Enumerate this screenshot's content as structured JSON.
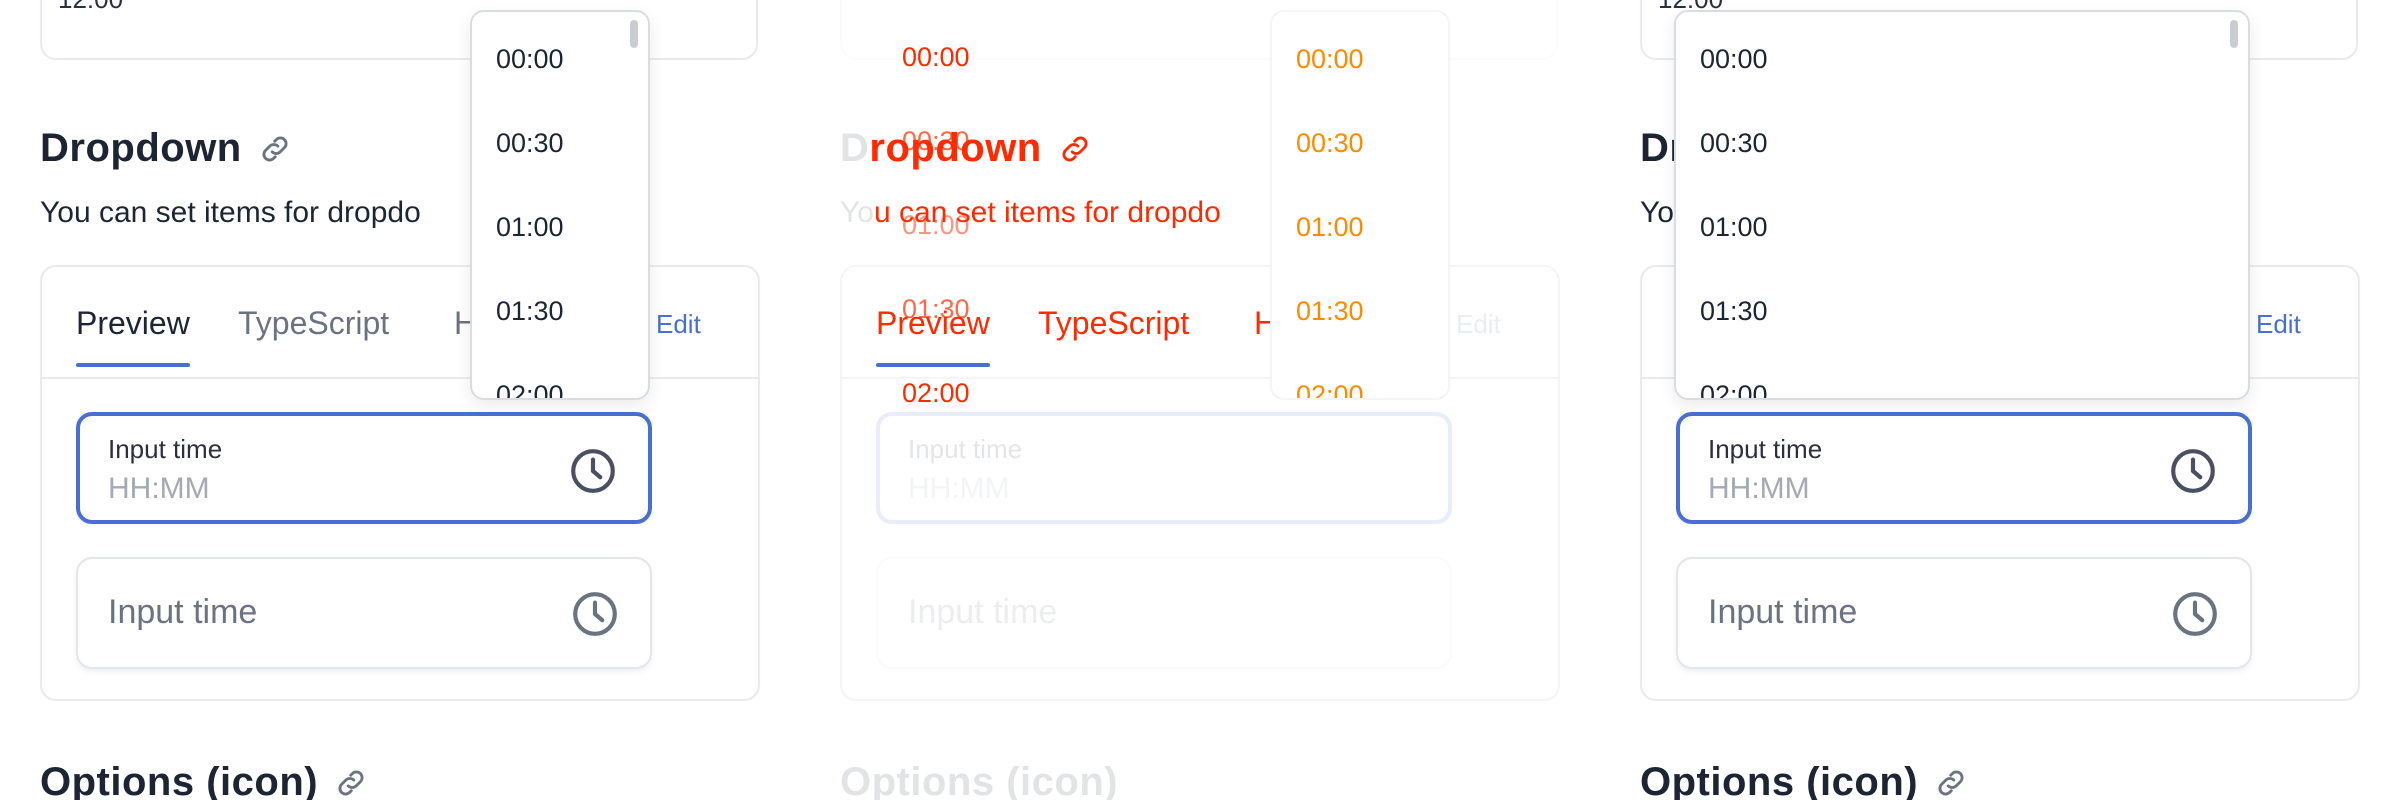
{
  "top_card": {
    "value": "12:00"
  },
  "dropdown_section": {
    "title": "Dropdown",
    "description_visible": "You can set items for dropdo",
    "description_visible_p2": "u can set items for dropdo"
  },
  "tabs": [
    {
      "label": "Preview"
    },
    {
      "label": "TypeScript"
    },
    {
      "label": "H"
    }
  ],
  "edit_label": "Edit",
  "fields": {
    "active": {
      "label": "Input time",
      "placeholder": "HH:MM"
    },
    "idle": {
      "placeholder": "Input time"
    }
  },
  "time_options": [
    "00:00",
    "00:30",
    "01:00",
    "01:30",
    "02:00"
  ],
  "next_section": {
    "title": "Options (icon)"
  },
  "colors": {
    "accent": "#4a6fd4",
    "highlight_red": "#ff2a00",
    "highlight_orange": "#ff8a00"
  },
  "icons": [
    "link-icon",
    "clock-icon"
  ]
}
